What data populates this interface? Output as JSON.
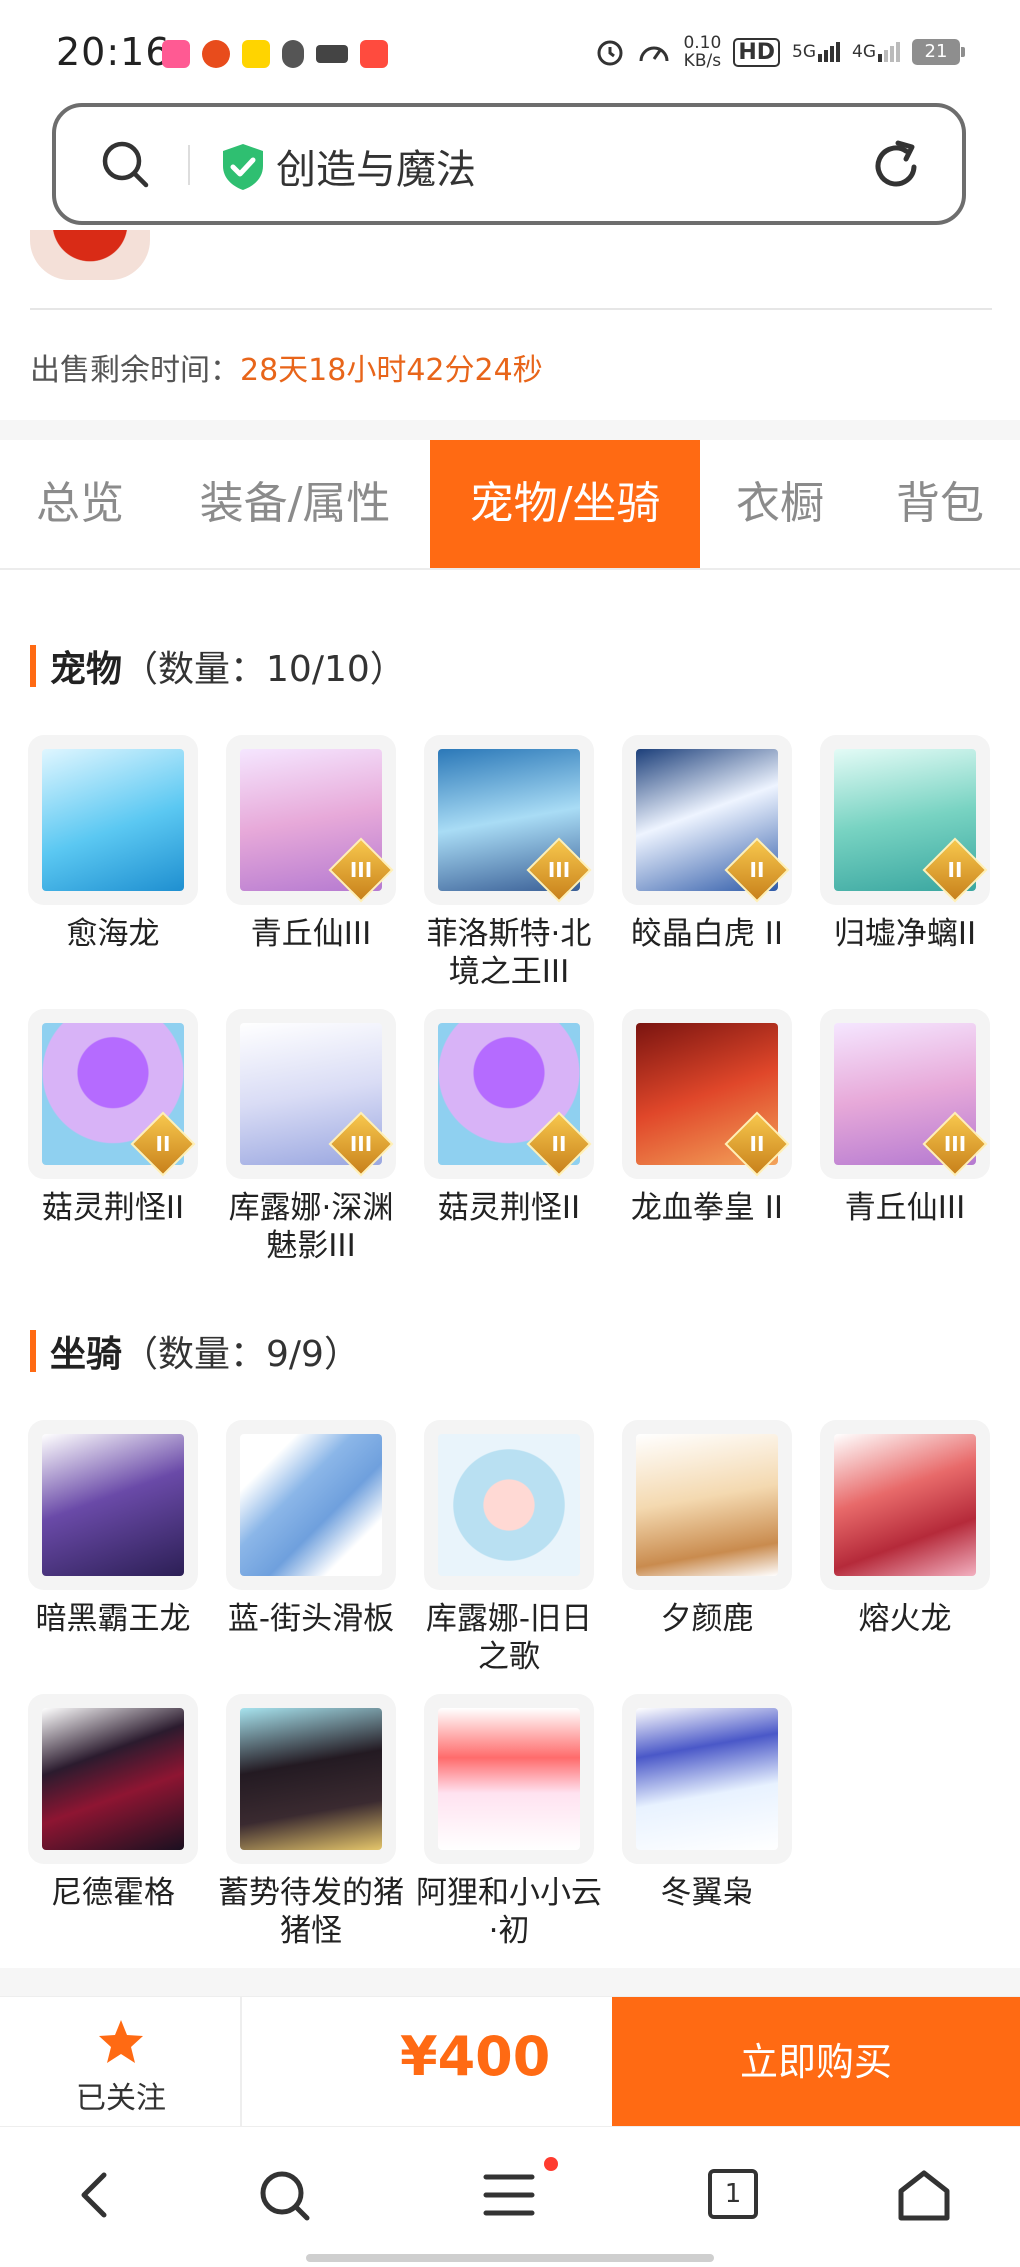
{
  "status_bar": {
    "time": "20:16",
    "net_speed_value": "0.10",
    "net_speed_unit": "KB/s",
    "hd": "HD",
    "signal_5g": "5G",
    "signal_4g": "4G",
    "battery": "21"
  },
  "url_bar": {
    "title": "创造与魔法"
  },
  "sale": {
    "label": "出售剩余时间：",
    "countdown": "28天18小时42分24秒"
  },
  "tabs": [
    {
      "label": "总览",
      "active": false
    },
    {
      "label": "装备/属性",
      "active": false
    },
    {
      "label": "宠物/坐骑",
      "active": true
    },
    {
      "label": "衣橱",
      "active": false
    },
    {
      "label": "背包",
      "active": false
    }
  ],
  "pets": {
    "title": "宠物",
    "count": "（数量：10/10）",
    "items": [
      {
        "name": "愈海龙",
        "badge": ""
      },
      {
        "name": "青丘仙III",
        "badge": "III"
      },
      {
        "name": "菲洛斯特·北境之王III",
        "badge": "III"
      },
      {
        "name": "皎晶白虎 II",
        "badge": "II"
      },
      {
        "name": "归墟净螭II",
        "badge": "II"
      },
      {
        "name": "菇灵荆怪II",
        "badge": "II"
      },
      {
        "name": "库露娜·深渊魅影III",
        "badge": "III"
      },
      {
        "name": "菇灵荆怪II",
        "badge": "II"
      },
      {
        "name": "龙血拳皇 II",
        "badge": "II"
      },
      {
        "name": "青丘仙III",
        "badge": "III"
      }
    ]
  },
  "mounts": {
    "title": "坐骑",
    "count": "（数量：9/9）",
    "items": [
      {
        "name": "暗黑霸王龙"
      },
      {
        "name": "蓝-街头滑板"
      },
      {
        "name": "库露娜-旧日之歌"
      },
      {
        "name": "夕颜鹿"
      },
      {
        "name": "熔火龙"
      },
      {
        "name": "尼德霍格"
      },
      {
        "name": "蓄势待发的猪猪怪"
      },
      {
        "name": "阿狸和小小云·初"
      },
      {
        "name": "冬翼枭"
      }
    ]
  },
  "buy_bar": {
    "follow_label": "已关注",
    "price": "¥400",
    "buy_label": "立即购买"
  },
  "nav": {
    "tab_count": "1"
  },
  "colors": {
    "accent": "#ff6a13",
    "countdown": "#e8651a"
  }
}
